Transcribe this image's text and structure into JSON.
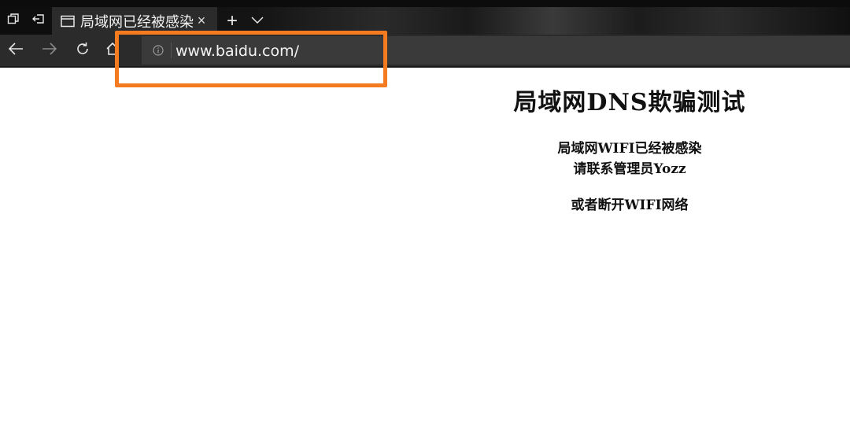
{
  "tab": {
    "title": "局域网已经被感染",
    "close_label": "×"
  },
  "tabstrip": {
    "new_tab_label": "+"
  },
  "address": {
    "url": "www.baidu.com/"
  },
  "page": {
    "heading": "局域网DNS欺骗测试",
    "line1": "局域网WIFI已经被感染",
    "line2": "请联系管理员Yozz",
    "line3": "或者断开WIFI网络"
  },
  "colors": {
    "highlight": "#f47b20",
    "chrome_dark": "#2b2b2b"
  }
}
